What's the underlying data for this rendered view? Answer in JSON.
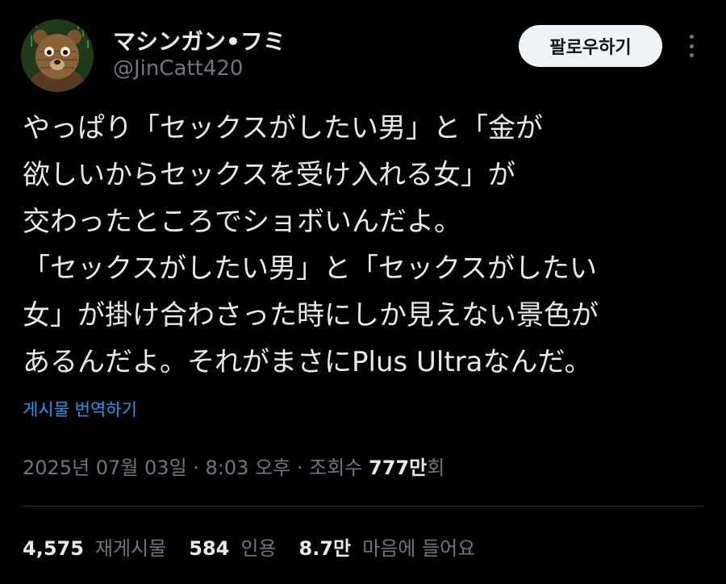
{
  "author": {
    "display_name": "マシンガン•フミ",
    "handle": "@JinCatt420",
    "avatar_icon": "bear-avatar-icon"
  },
  "actions": {
    "follow_label": "팔로우하기",
    "more_icon": "more-dots-icon"
  },
  "tweet": {
    "lines": [
      "やっぱり「セックスがしたい男」と「金が",
      "欲しいからセックスを受け入れる女」が",
      "交わったところでショボいんだよ。",
      "「セックスがしたい男」と「セックスがしたい",
      "女」が掛け合わさった時にしか見えない景色が",
      "あるんだよ。それがまさにPlus Ultraなんだ。"
    ],
    "translate_label": "게시물 번역하기"
  },
  "meta": {
    "date": "2025년 07월 03일",
    "sep1": " · ",
    "time": "8:03 오후",
    "sep2": " · ",
    "views_label": "조회수 ",
    "views_count": "777만",
    "views_suffix": "회"
  },
  "stats": {
    "reposts_count": "4,575",
    "reposts_label": "재게시물",
    "quotes_count": "584",
    "quotes_label": "인용",
    "likes_count": "8.7만",
    "likes_label": "마음에 들어요"
  },
  "colors": {
    "background": "#000000",
    "text_primary": "#e7e9ea",
    "text_secondary": "#71767b",
    "link": "#1d9bf0",
    "follow_bg": "#eff3f4"
  }
}
